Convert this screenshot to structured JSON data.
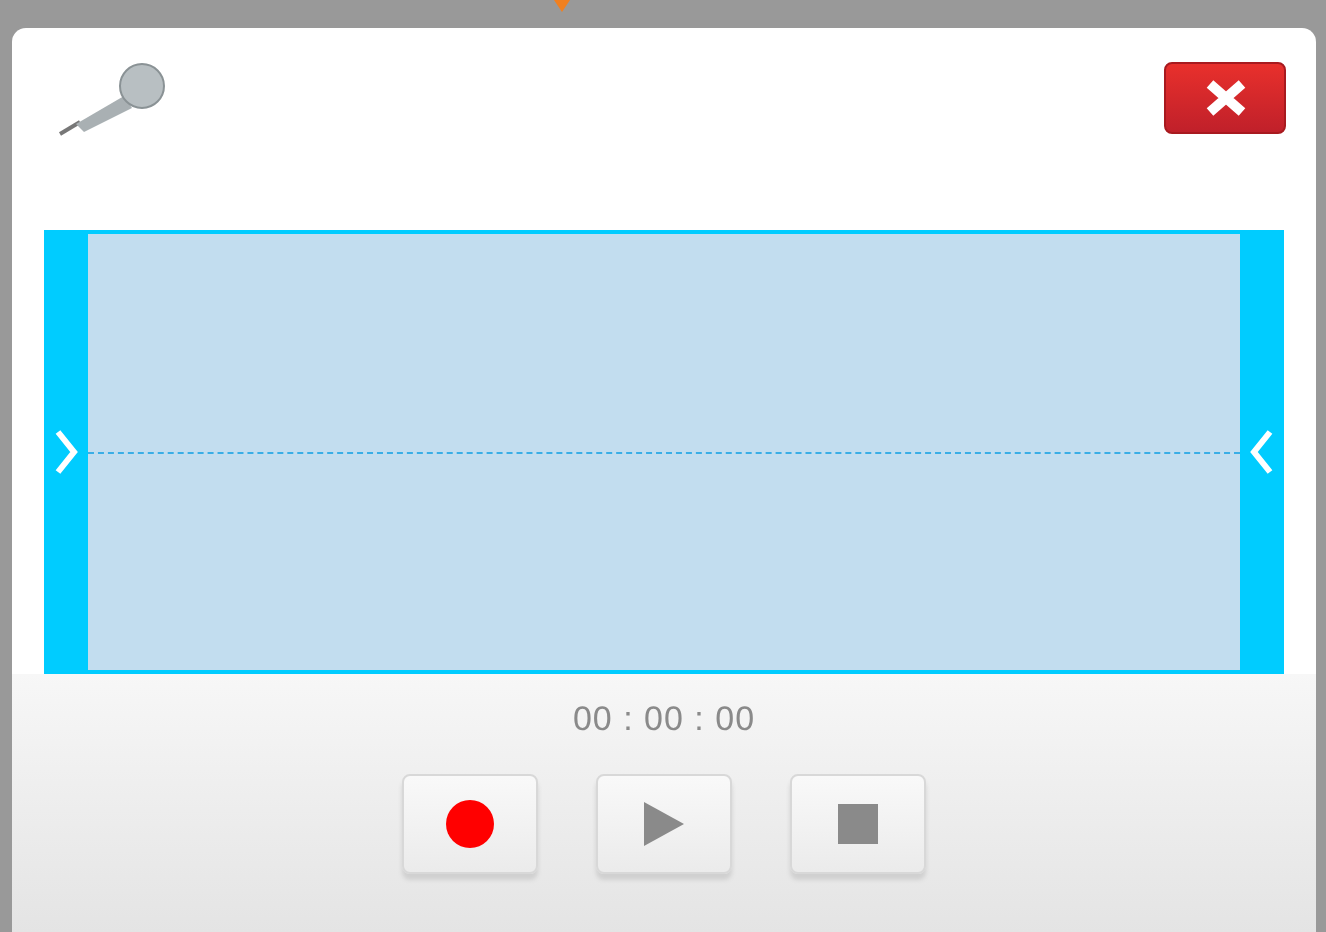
{
  "timer": "00 : 00 : 00",
  "controls": [
    {
      "kind": "record"
    },
    {
      "kind": "play"
    },
    {
      "kind": "stop"
    }
  ]
}
